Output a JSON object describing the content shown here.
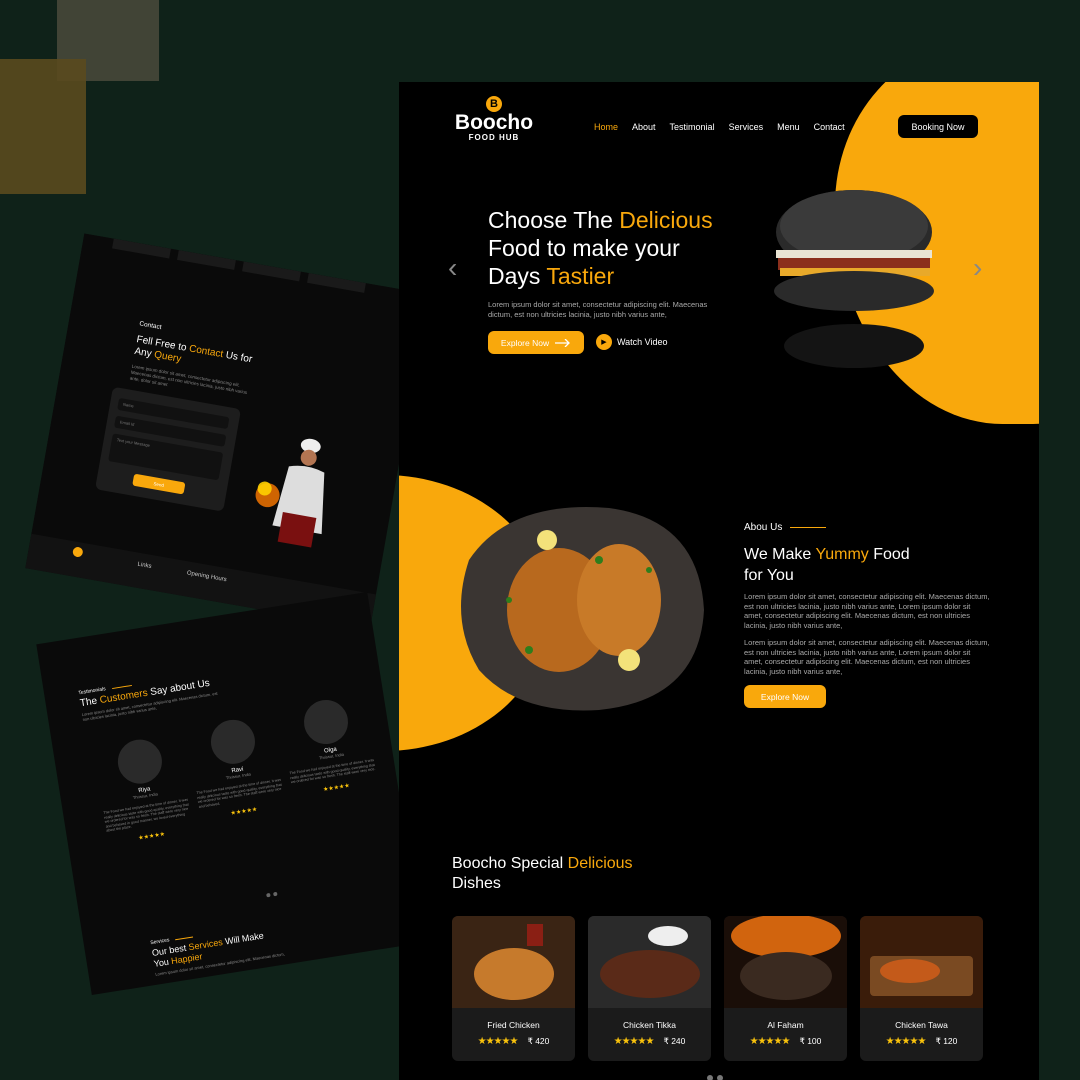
{
  "brand": {
    "name": "Boocho",
    "sub": "FOOD HUB",
    "badge": "B"
  },
  "nav": {
    "items": [
      "Home",
      "About",
      "Testimonial",
      "Services",
      "Menu",
      "Contact"
    ],
    "active": "Home",
    "cta": "Booking Now"
  },
  "hero": {
    "title_a": "Choose The ",
    "title_hl": "Delicious",
    "title_b": "Food to make your",
    "title_c": "Days ",
    "title_hl2": "Tastier",
    "desc": "Lorem ipsum dolor sit amet, consectetur adipiscing elit. Maecenas dictum, est non ultricies lacinia, justo nibh varius ante,",
    "cta": "Explore Now",
    "cta_icon": "arrow-right-icon",
    "watch": "Watch Video",
    "prev": "‹",
    "next": "›"
  },
  "about": {
    "label": "Abou Us",
    "title_a": "We Make ",
    "title_hl": "Yummy",
    "title_b": " Food",
    "title_c": "for You",
    "p1": "Lorem ipsum dolor sit amet, consectetur adipiscing elit. Maecenas dictum, est non ultricies lacinia, justo nibh varius ante, Lorem ipsum dolor sit amet, consectetur adipiscing elit. Maecenas dictum, est non ultricies lacinia, justo nibh varius ante,",
    "p2": "Lorem ipsum dolor sit amet, consectetur adipiscing elit. Maecenas dictum, est non ultricies lacinia, justo nibh varius ante, Lorem ipsum dolor sit amet, consectetur adipiscing elit. Maecenas dictum, est non ultricies lacinia, justo nibh varius ante,",
    "cta": "Explore Now"
  },
  "special": {
    "title_a": "Boocho Special ",
    "title_hl": "Delicious",
    "title_b": "Dishes",
    "dishes": [
      {
        "name": "Fried Chicken",
        "price": "₹ 420",
        "stars": "★★★★★"
      },
      {
        "name": "Chicken Tikka",
        "price": "₹ 240",
        "stars": "★★★★★"
      },
      {
        "name": "Al Faham",
        "price": "₹ 100",
        "stars": "★★★★★"
      },
      {
        "name": "Chicken Tawa",
        "price": "₹ 120",
        "stars": "★★★★★"
      }
    ]
  },
  "mock_contact": {
    "label": "Contact",
    "title_a": "Fell Free to ",
    "title_hl": "Contact",
    "title_b": " Us for",
    "title_c": "Any ",
    "title_hl2": "Query",
    "desc": "Lorem ipsum dolor sit amet, consectetur adipiscing elit. Maecenas dictum, est non ultricies lacinia, justo nibh varius ante, dolor sit amet",
    "field1": "Name",
    "field2": "Email Id",
    "field3": "Text your Message",
    "send": "Send",
    "links": "Links",
    "hours": "Opening Hours"
  },
  "mock_testimonials": {
    "label": "Testimonials",
    "title_a": "The ",
    "title_hl": "Customers",
    "title_b": " Say about Us",
    "desc": "Lorem ipsum dolor sit amet, consectetur adipiscing elit. Maecenas dictum, est non ultricies lacinia, justo nibh varius ante,",
    "cards": [
      {
        "name": "Riya",
        "role": "Thrissur, India",
        "text": "The Food we had enjoyed at the time of dinner. It was really delicious taste with good quality, everything that we ordered for was so fresh. The staff were very nice and behaved in good manner. we loved everything about the place.",
        "stars": "★★★★★"
      },
      {
        "name": "Ravi",
        "role": "Thrissur, India",
        "text": "The Food we had enjoyed at the time of dinner. It was really delicious taste with good quality, everything that we ordered for was so fresh. The staff were very nice and behaved.",
        "stars": "★★★★★"
      },
      {
        "name": "Olga",
        "role": "Thrissur, India",
        "text": "The Food we had enjoyed at the time of dinner. It was really delicious taste with good quality, everything that we ordered for was so fresh. The staff were very nice.",
        "stars": "★★★★★"
      }
    ],
    "services_label": "Services",
    "services_a": "Our best ",
    "services_hl": "Services",
    "services_b": " Will Make",
    "services_c": "You ",
    "services_hl2": "Happier",
    "services_desc": "Lorem ipsum dolor sit amet, consectetur adipiscing elit. Maecenas dictum,"
  },
  "colors": {
    "accent": "#f9a80c",
    "bg": "#0f2219",
    "page": "#000000"
  }
}
